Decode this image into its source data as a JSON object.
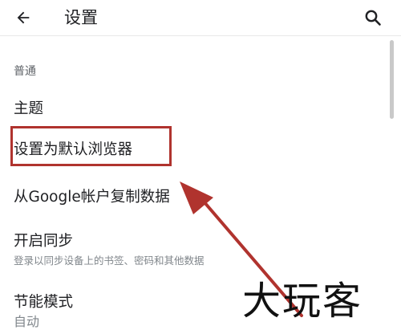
{
  "header": {
    "back_icon": "arrow-left-icon",
    "title": "设置",
    "search_icon": "search-icon"
  },
  "section": {
    "header": "普通"
  },
  "items": [
    {
      "label": "主题"
    },
    {
      "label": "设置为默认浏览器"
    },
    {
      "label": "从Google帐户复制数据"
    },
    {
      "label": "开启同步",
      "sub": "登录以同步设备上的书签、密码和其他数据"
    },
    {
      "label": "节能模式",
      "sub": "自动"
    }
  ],
  "annotation": {
    "highlight_color": "#b0332e",
    "arrow_color": "#b0332e"
  },
  "watermark": "大玩客"
}
